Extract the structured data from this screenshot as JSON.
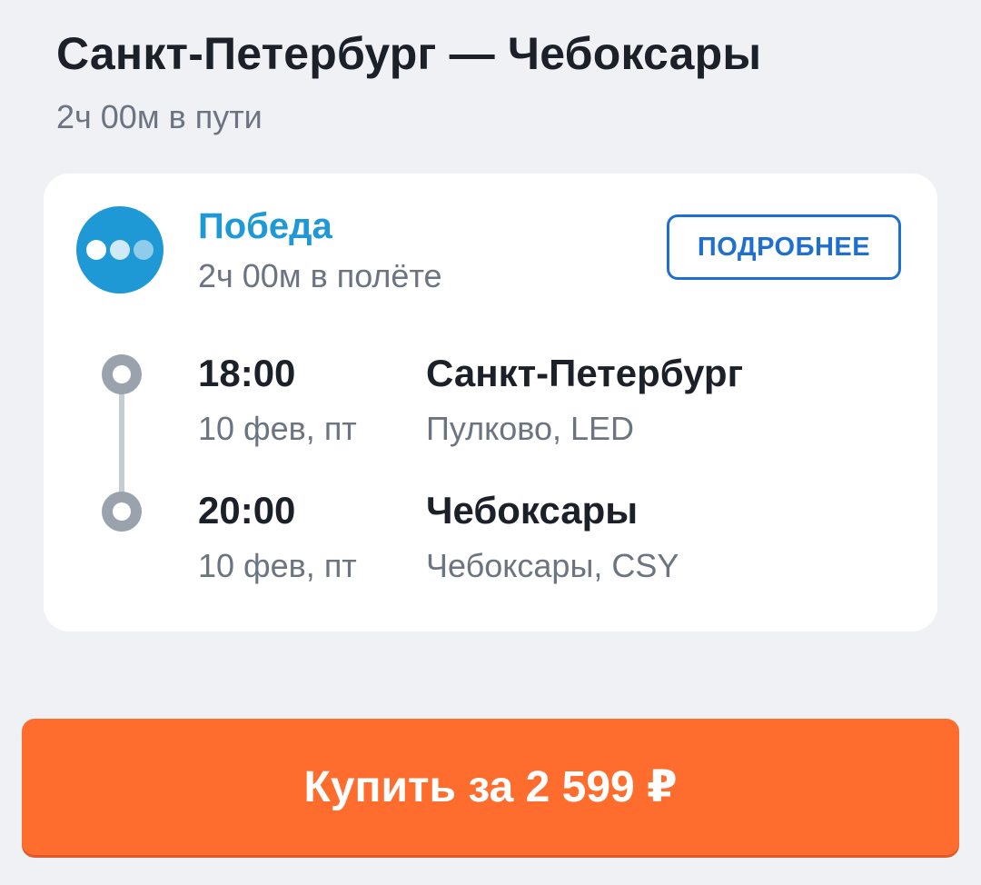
{
  "route": {
    "title": "Санкт-Петербург — Чебоксары",
    "duration": "2ч 00м в пути"
  },
  "flight": {
    "airline": "Победа",
    "flight_duration": "2ч 00м в полёте",
    "details_button": "ПОДРОБНЕЕ",
    "departure": {
      "time": "18:00",
      "date": "10 фев, пт",
      "city": "Санкт-Петербург",
      "airport": "Пулково, LED"
    },
    "arrival": {
      "time": "20:00",
      "date": "10 фев, пт",
      "city": "Чебоксары",
      "airport": "Чебоксары, CSY"
    }
  },
  "buy_button": {
    "label": "Купить за 2 599 ₽"
  },
  "colors": {
    "accent": "#1f6fd1",
    "airline_brand": "#1e99d6",
    "buy_button": "#ff6d2e",
    "background": "#eff1f5"
  },
  "icons": {
    "airline_logo": "pobeda-logo-icon",
    "departure_marker": "timeline-dot-icon",
    "arrival_marker": "timeline-dot-icon"
  }
}
